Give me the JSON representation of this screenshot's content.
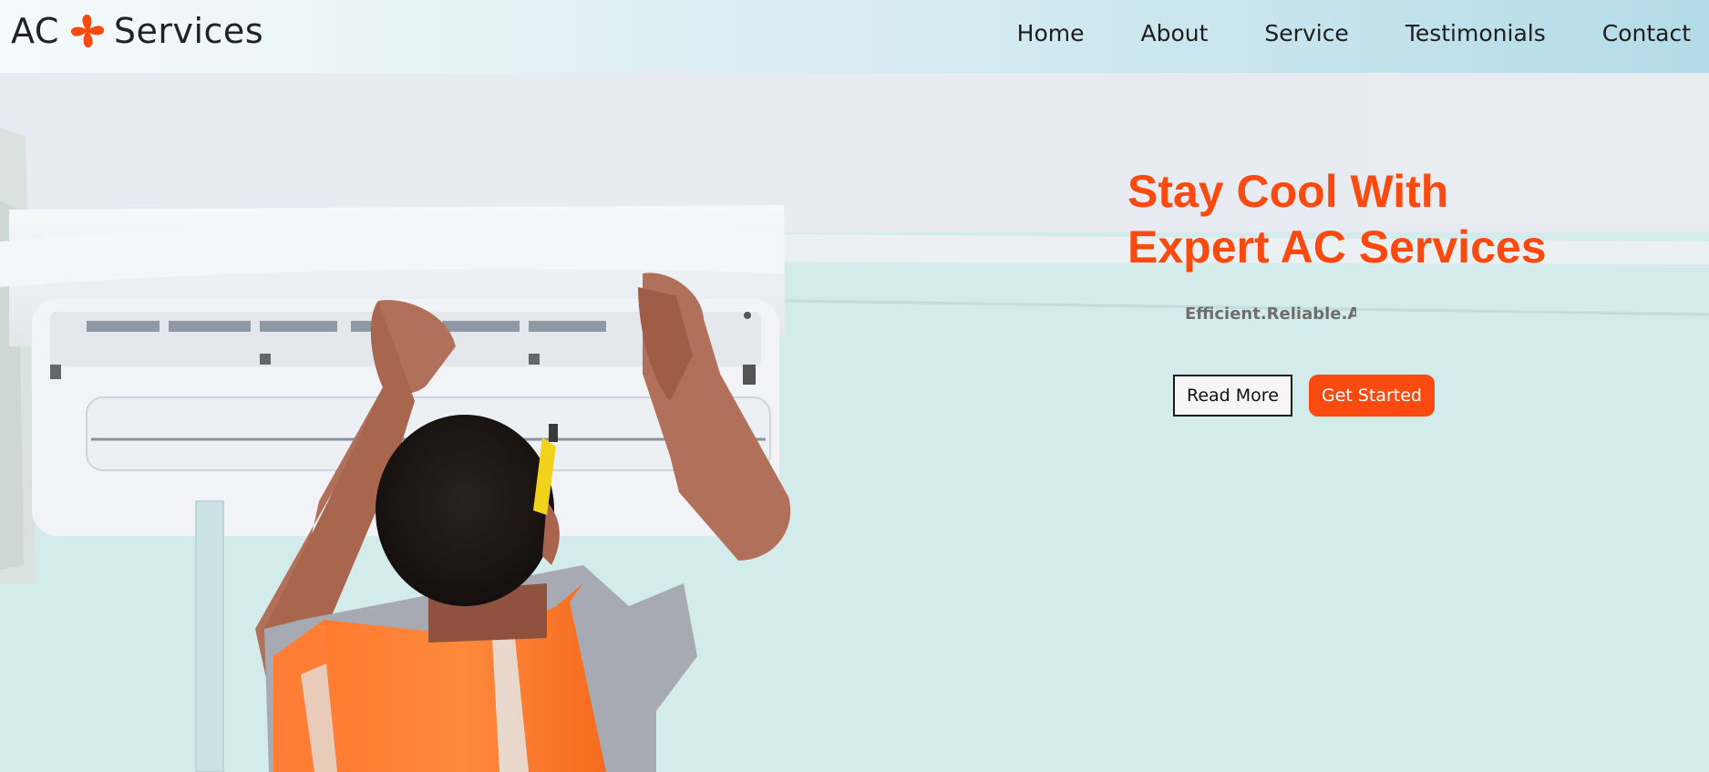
{
  "brand": {
    "prefix": "AC",
    "suffix": "Services",
    "icon": "fan-icon",
    "accent_color": "#fb4a0f"
  },
  "nav": {
    "items": [
      {
        "label": "Home"
      },
      {
        "label": "About"
      },
      {
        "label": "Service"
      },
      {
        "label": "Testimonials"
      },
      {
        "label": "Contact"
      }
    ]
  },
  "hero": {
    "title_line1": "Stay Cool With",
    "title_line2": "Expert AC Services",
    "tagline": "Efficient.Reliable.Affc",
    "read_more_label": "Read More",
    "get_started_label": "Get Started",
    "title_color": "#fb4a0f"
  }
}
